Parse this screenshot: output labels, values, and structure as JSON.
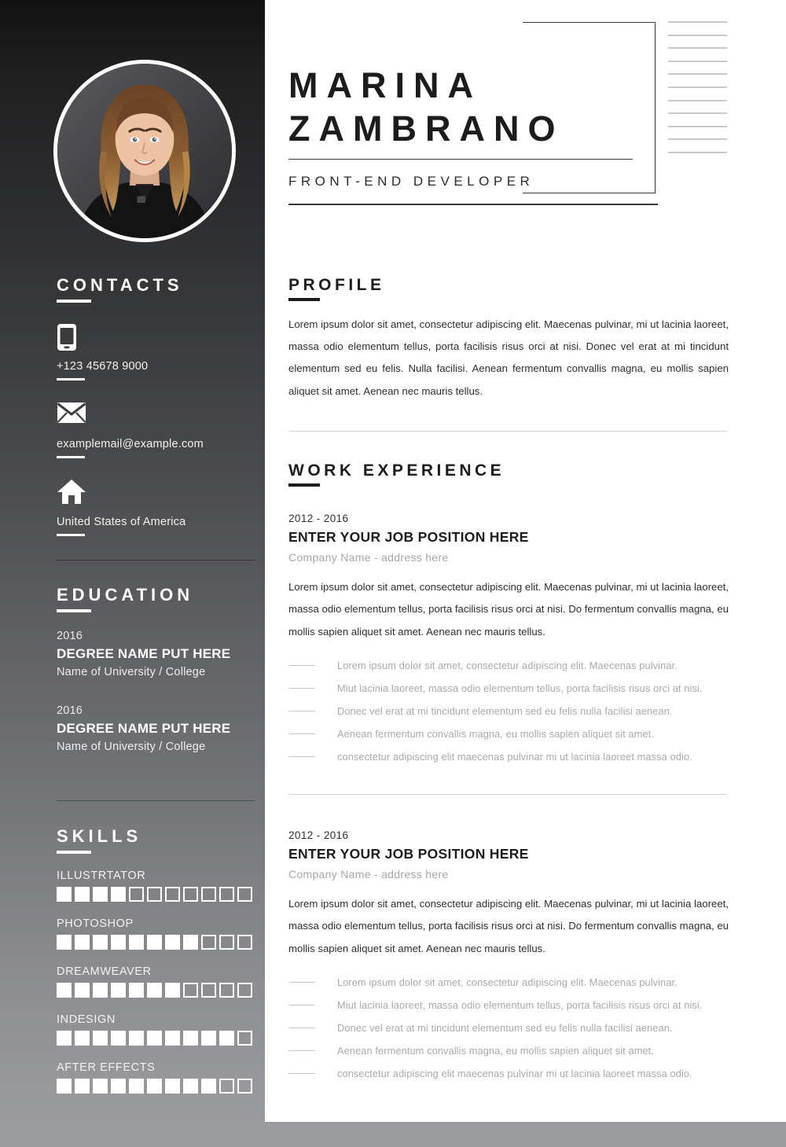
{
  "header": {
    "name_first": "MARINA",
    "name_last": "ZAMBRANO",
    "job_title": "FRONT-END DEVELOPER",
    "decorative_line_count": 11
  },
  "sidebar": {
    "photo_alt": "portrait-photo",
    "contacts": {
      "heading": "CONTACTS",
      "items": [
        {
          "icon": "phone-icon",
          "text": "+123 45678 9000"
        },
        {
          "icon": "email-icon",
          "text": "examplemail@example.com"
        },
        {
          "icon": "home-icon",
          "text": "United States of America"
        }
      ]
    },
    "education": {
      "heading": "EDUCATION",
      "items": [
        {
          "year": "2016",
          "degree": "DEGREE NAME PUT HERE",
          "school": "Name of University / College"
        },
        {
          "year": "2016",
          "degree": "DEGREE NAME PUT HERE",
          "school": "Name of University / College"
        }
      ]
    },
    "skills": {
      "heading": "SKILLS",
      "total_squares": 11,
      "items": [
        {
          "name": "ILLUSTRTATOR",
          "filled": 4
        },
        {
          "name": "PHOTOSHOP",
          "filled": 8
        },
        {
          "name": "DREAMWEAVER",
          "filled": 7
        },
        {
          "name": "INDESIGN",
          "filled": 10
        },
        {
          "name": "AFTER EFFECTS",
          "filled": 9
        }
      ]
    }
  },
  "main": {
    "profile": {
      "heading": "PROFILE",
      "text": "Lorem ipsum dolor sit amet, consectetur adipiscing elit. Maecenas pulvinar, mi ut lacinia laoreet, massa odio elementum tellus, porta facilisis risus orci at nisi. Donec vel erat at mi tincidunt elementum sed eu felis. Nulla facilisi. Aenean fermentum convallis magna, eu mollis sapien aliquet sit amet. Aenean nec mauris tellus."
    },
    "work_experience": {
      "heading": "WORK EXPERIENCE",
      "jobs": [
        {
          "years": "2012 - 2016",
          "position": "ENTER YOUR JOB POSITION HERE",
          "company": "Company Name - address here",
          "description": "Lorem ipsum dolor sit amet, consectetur adipiscing elit. Maecenas pulvinar, mi ut lacinia laoreet, massa odio elementum tellus, porta facilisis risus orci at nisi. Do fermentum convallis magna, eu mollis sapien aliquet sit amet. Aenean nec mauris tellus.",
          "bullets": [
            "Lorem ipsum dolor sit amet, consectetur adipiscing elit. Maecenas pulvinar.",
            "Miut lacinia laoreet, massa odio elementum tellus, porta facilisis risus orci at nisi.",
            "Donec vel erat at mi tincidunt elementum sed eu felis nulla facilisi aenean.",
            "Aenean fermentum convallis magna, eu mollis sapien aliquet sit amet.",
            "consectetur adipiscing elit maecenas pulvinar mi ut lacinia laoreet massa odio."
          ]
        },
        {
          "years": "2012 - 2016",
          "position": "ENTER YOUR JOB POSITION HERE",
          "company": "Company Name - address here",
          "description": "Lorem ipsum dolor sit amet, consectetur adipiscing elit. Maecenas pulvinar, mi ut lacinia laoreet, massa odio elementum tellus, porta facilisis risus orci at nisi. Do fermentum convallis magna, eu mollis sapien aliquet sit amet. Aenean nec mauris tellus.",
          "bullets": [
            "Lorem ipsum dolor sit amet, consectetur adipiscing elit. Maecenas pulvinar.",
            "Miut lacinia laoreet, massa odio elementum tellus, porta facilisis risus orci at nisi.",
            "Donec vel erat at mi tincidunt elementum sed eu felis nulla facilisi aenean.",
            "Aenean fermentum convallis magna, eu mollis sapien aliquet sit amet.",
            "consectetur adipiscing elit maecenas pulvinar mi ut lacinia laoreet massa odio."
          ]
        }
      ]
    }
  },
  "colors": {
    "page_bg": "#ffffff",
    "outer_bg": "#9a9c9f",
    "sidebar_top": "#111111",
    "sidebar_bottom": "#9a9b9e",
    "ink": "#1c1c1c",
    "muted": "#a9a9ab",
    "rule_light": "#d4d4d6"
  }
}
